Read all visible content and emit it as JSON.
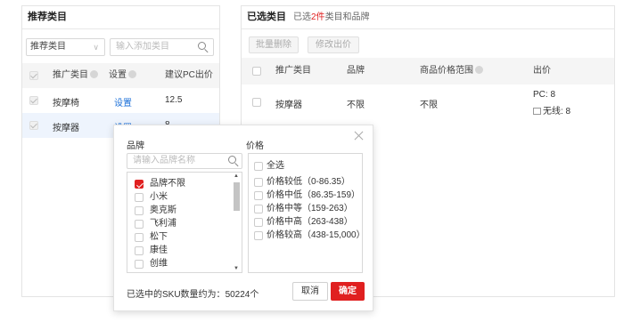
{
  "left_panel": {
    "title": "推荐类目",
    "select_value": "推荐类目",
    "search_placeholder": "输入添加类目",
    "headers": [
      "推广类目",
      "设置",
      "建议PC出价"
    ],
    "rows": [
      {
        "name": "按摩椅",
        "action": "设置",
        "price": "12.5"
      },
      {
        "name": "按摩器",
        "action": "设置",
        "price": "8"
      }
    ]
  },
  "right_panel": {
    "title": "已选类目",
    "subtitle_prefix": "已选",
    "subtitle_count": "2件",
    "subtitle_suffix": "类目和品牌",
    "batch_delete": "批量删除",
    "modify_bid": "修改出价",
    "headers": [
      "推广类目",
      "品牌",
      "商品价格范围",
      "出价"
    ],
    "row": {
      "name": "按摩器",
      "brand": "不限",
      "range": "不限",
      "bid_pc": "PC: 8",
      "bid_wireless": "无线: 8"
    }
  },
  "popup": {
    "brand_label": "品牌",
    "price_label": "价格",
    "brand_search_placeholder": "请输入品牌名称",
    "brands": [
      "品牌不限",
      "小米",
      "奥克斯",
      "飞利浦",
      "松下",
      "康佳",
      "创维"
    ],
    "brand_checked": [
      true,
      false,
      false,
      false,
      false,
      false,
      false
    ],
    "select_all": "全选",
    "prices": [
      "价格较低（0-86.35）",
      "价格中低（86.35-159）",
      "价格中等（159-263）",
      "价格中高（263-438）",
      "价格较高（438-15,000）"
    ],
    "footer_prefix": "已选中的SKU数量约为：",
    "footer_count": "50224",
    "footer_suffix": "个",
    "cancel": "取消",
    "confirm": "确定"
  },
  "colors": {
    "accent": "#e02020",
    "link": "#1a6fd8"
  }
}
